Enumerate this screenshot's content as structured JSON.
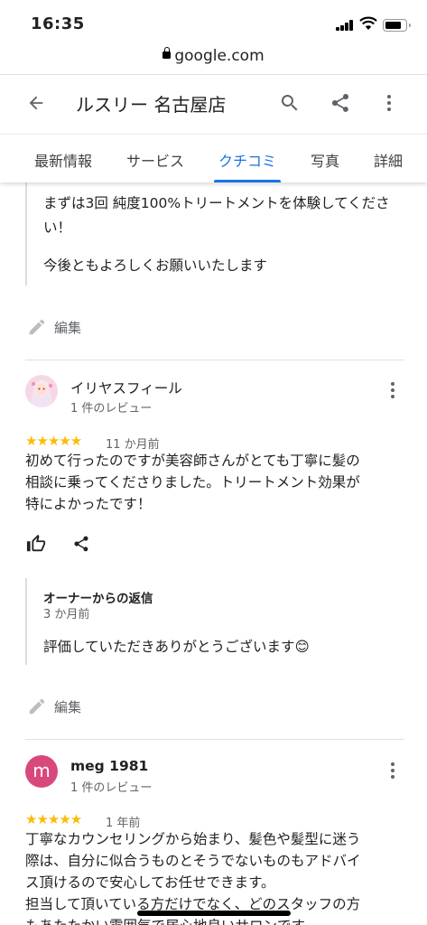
{
  "status": {
    "time": "16:35"
  },
  "browser": {
    "url": "google.com"
  },
  "appbar": {
    "title": "ルスリー 名古屋店"
  },
  "tabs": [
    {
      "label": "最新情報"
    },
    {
      "label": "サービス"
    },
    {
      "label": "クチコミ",
      "active": true
    },
    {
      "label": "写真"
    },
    {
      "label": "詳細"
    }
  ],
  "prev_reply": {
    "line1": "まずは3回 純度100%トリートメントを体験してくださ",
    "line2": "い！",
    "line3": "今後ともよろしくお願いいたします"
  },
  "edit_label": "編集",
  "reviews": [
    {
      "name": "イリヤスフィール",
      "count": "1 件のレビュー",
      "stars": "★★★★★",
      "date": "11 か月前",
      "text": [
        "初めて行ったのですが美容師さんがとても丁寧に髪の",
        "相談に乗ってくださりました。トリートメント効果が",
        "特によかったです！"
      ],
      "owner_reply": {
        "title": "オーナーからの返信",
        "date": "3 か月前",
        "text": "評価していただきありがとうございます😊"
      }
    },
    {
      "name": "meg 1981",
      "avatar_letter": "m",
      "avatar_color": "#d9487d",
      "count": "1 件のレビュー",
      "stars": "★★★★★",
      "date": "1 年前",
      "text": [
        "丁寧なカウンセリングから始まり、髪色や髪型に迷う",
        "際は、自分に似合うものとそうでないものもアドバイ",
        "ス頂けるので安心してお任せできます。",
        "担当して頂いている方だけでなく、どのスタッフの方",
        "もあたたかい雰囲気で居心地良いサロンです"
      ]
    }
  ],
  "colors": {
    "accent": "#1a73e8",
    "star": "#fbbc04"
  }
}
